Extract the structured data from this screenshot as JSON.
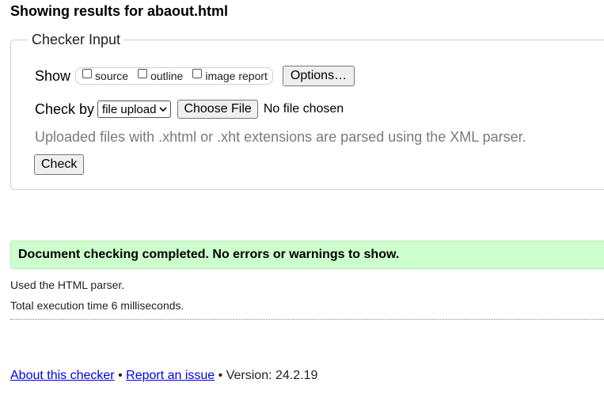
{
  "header": {
    "title": "Showing results for abaout.html"
  },
  "checker_input": {
    "legend": "Checker Input",
    "show_label": "Show",
    "checkboxes": [
      {
        "label": "source",
        "checked": false
      },
      {
        "label": "outline",
        "checked": false
      },
      {
        "label": "image report",
        "checked": false
      }
    ],
    "options_label": "Options…",
    "check_by_label": "Check by",
    "check_by_selected": "file upload",
    "choose_file_label": "Choose File",
    "file_status": "No file chosen",
    "hint": "Uploaded files with .xhtml or .xht extensions are parsed using the XML parser.",
    "check_label": "Check"
  },
  "results": {
    "success_message": "Document checking completed. No errors or warnings to show.",
    "parser_info": "Used the HTML parser.",
    "execution_time": "Total execution time 6 milliseconds."
  },
  "footer": {
    "about_link": "About this checker",
    "separator": "•",
    "report_link": "Report an issue",
    "version": "Version: 24.2.19"
  },
  "colors": {
    "success_bg": "#ccffcc",
    "link": "#0000ee",
    "hint_text": "#7a7a7a"
  }
}
